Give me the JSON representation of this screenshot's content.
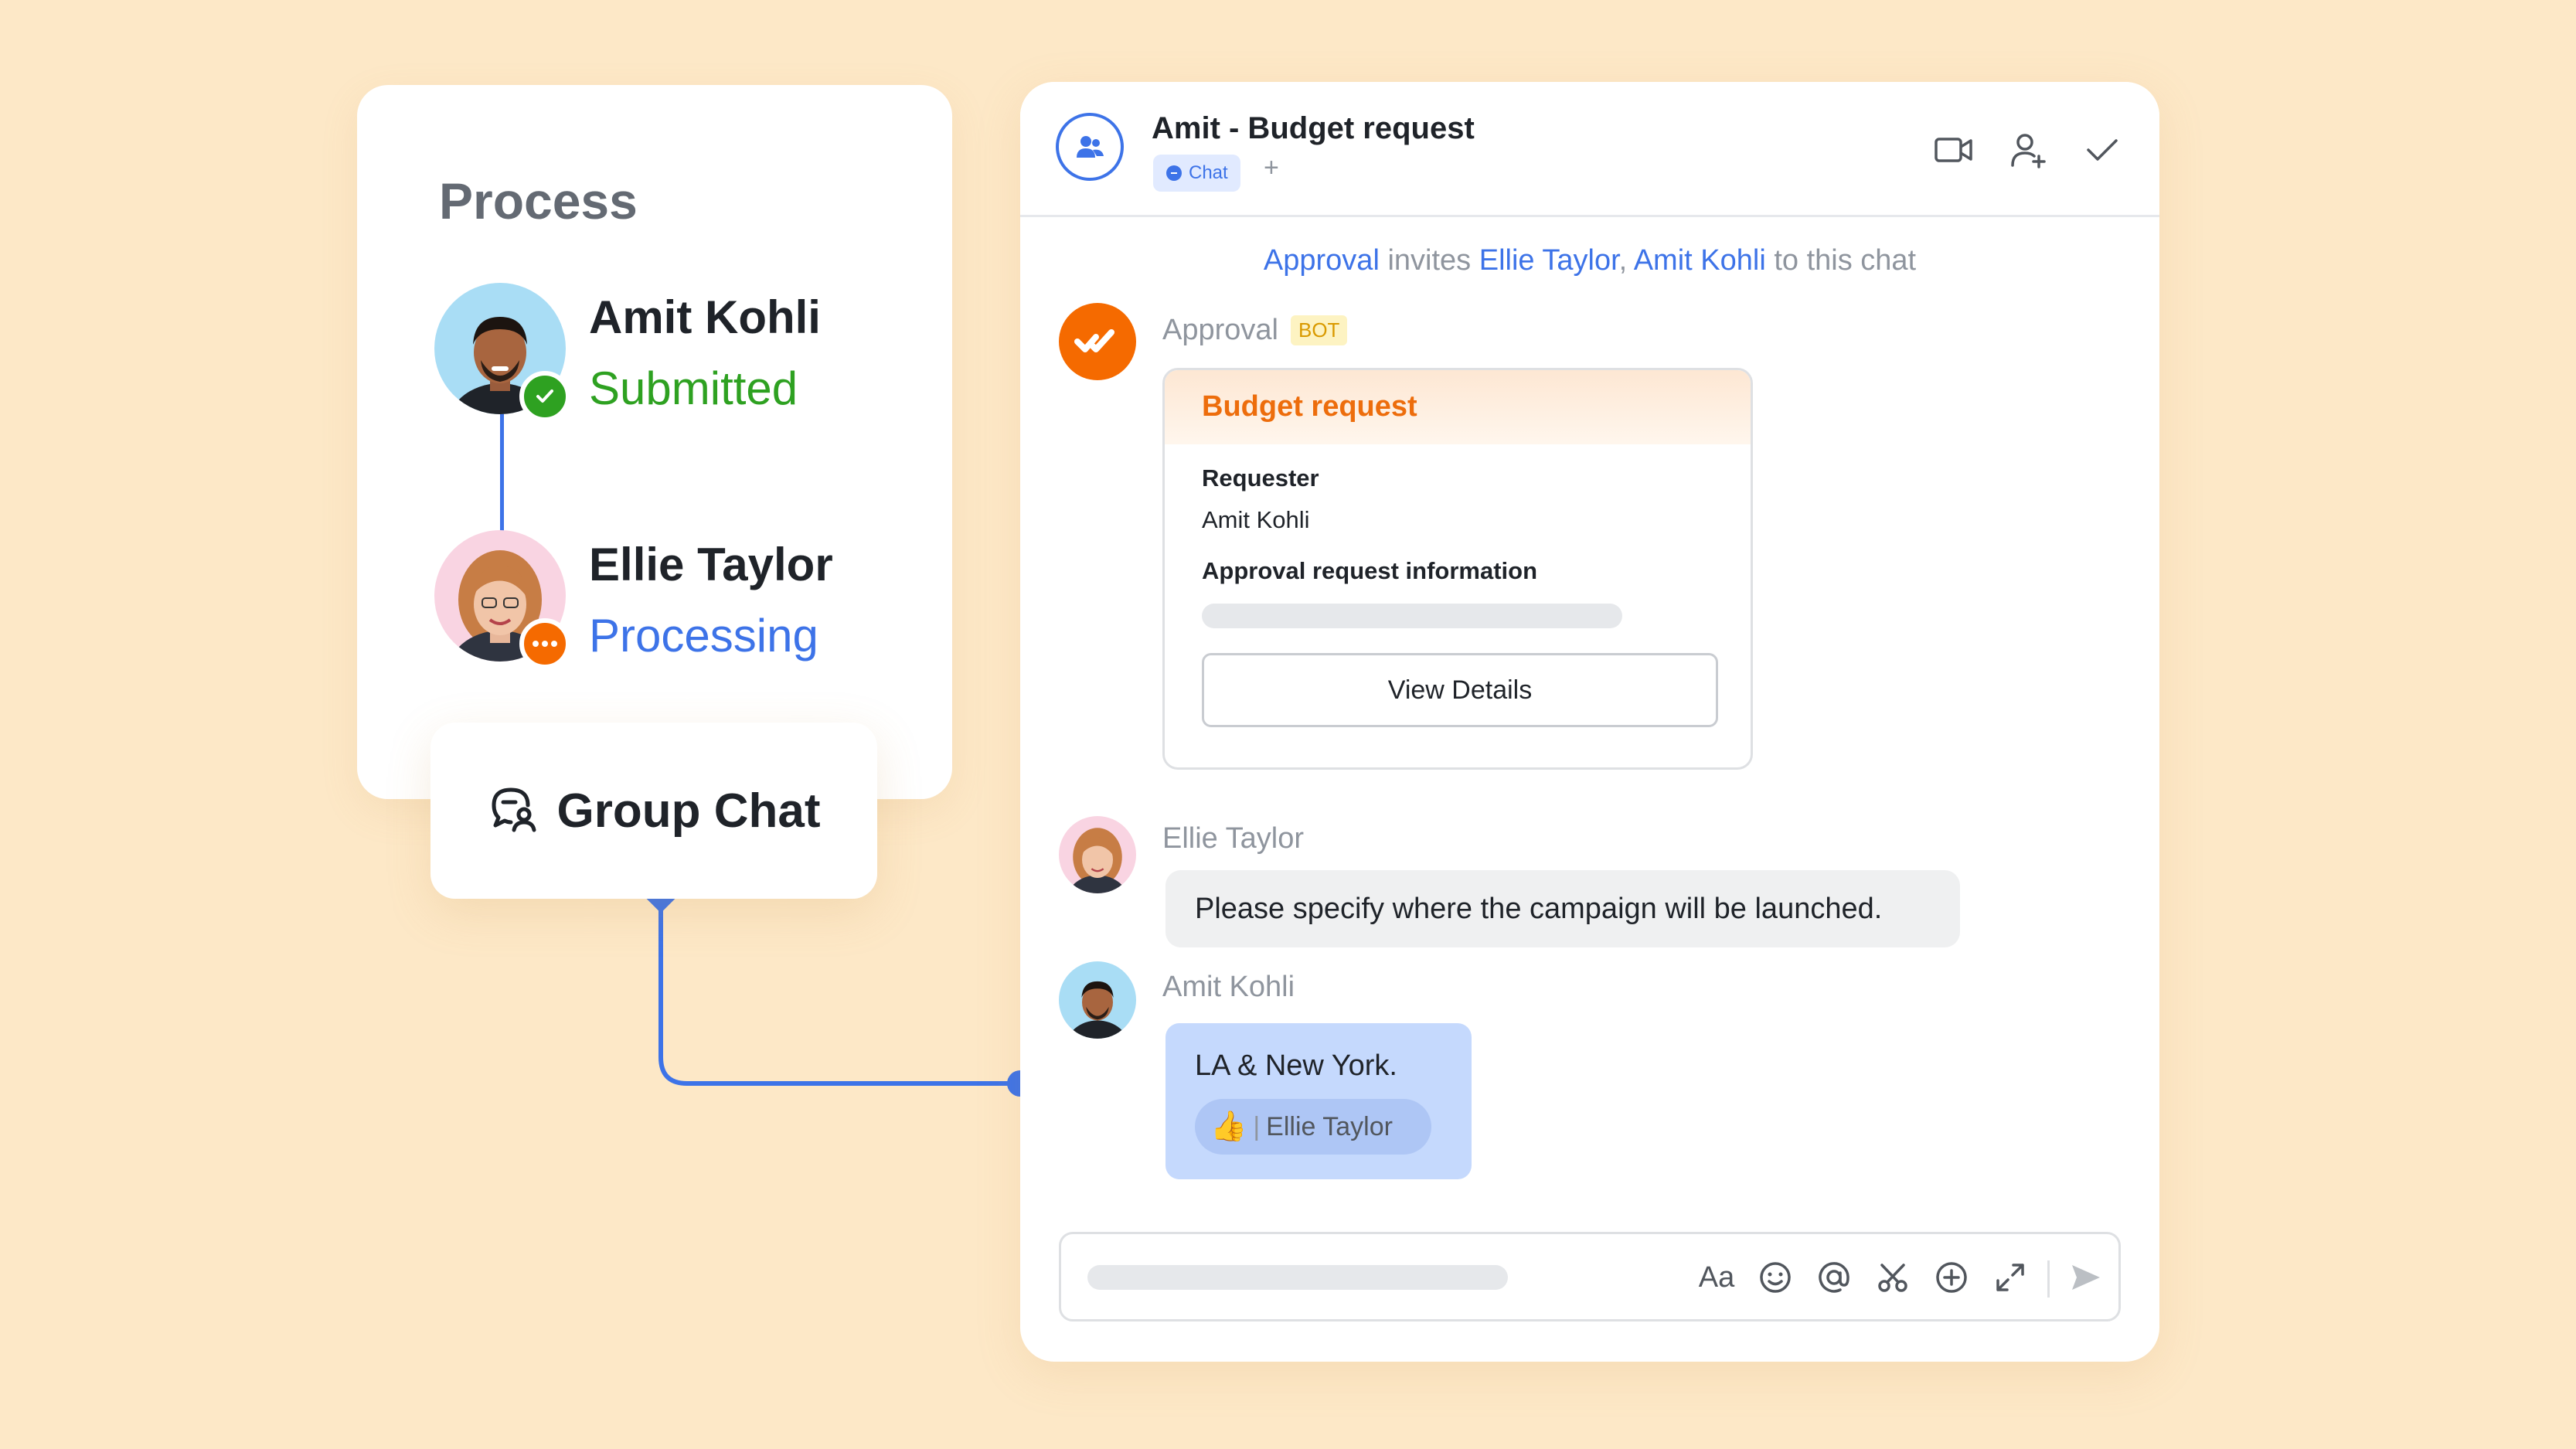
{
  "process": {
    "title": "Process",
    "steps": [
      {
        "name": "Amit Kohli",
        "status": "Submitted",
        "status_color": "#2ea121",
        "badge_icon": "check-icon"
      },
      {
        "name": "Ellie Taylor",
        "status": "Processing",
        "status_color": "#3d73e8",
        "badge_icon": "ellipsis-icon"
      }
    ]
  },
  "group_chat": {
    "label": "Group Chat",
    "icon": "group-chat-icon"
  },
  "chat": {
    "title": "Amit - Budget request",
    "tag": "Chat",
    "tag_plus": "+",
    "header_icons": [
      "video-call-icon",
      "add-member-icon",
      "checkmark-icon"
    ],
    "system_message": {
      "actor": "Approval",
      "verb": " invites ",
      "invitee1": "Ellie Taylor",
      "sep": ", ",
      "invitee2": "Amit Kohli",
      "suffix": " to this chat"
    },
    "bot_message": {
      "sender": "Approval",
      "badge": "BOT",
      "card": {
        "title": "Budget request",
        "requester_label": "Requester",
        "requester_value": "Amit Kohli",
        "info_label": "Approval request information",
        "button": "View Details"
      }
    },
    "messages": [
      {
        "sender": "Ellie Taylor",
        "text": "Please specify where the campaign will be launched."
      },
      {
        "sender": "Amit Kohli",
        "text": "LA & New York.",
        "reaction": {
          "emoji": "👍",
          "by": "Ellie Taylor"
        }
      }
    ],
    "input": {
      "toolbar_icons": [
        "text-format-icon",
        "emoji-icon",
        "mention-icon",
        "scissors-icon",
        "add-icon",
        "expand-icon",
        "send-icon"
      ],
      "format_label": "Aa"
    }
  },
  "colors": {
    "background": "#fde8c7",
    "accent": "#3d73e8",
    "bot_orange": "#f56a00",
    "success": "#2ea121"
  }
}
